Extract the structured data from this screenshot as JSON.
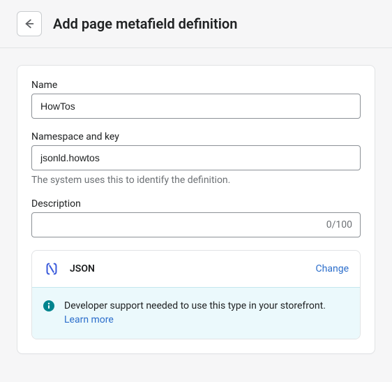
{
  "header": {
    "title": "Add page metafield definition"
  },
  "form": {
    "name": {
      "label": "Name",
      "value": "HowTos"
    },
    "namespace": {
      "label": "Namespace and key",
      "value": "jsonld.howtos",
      "help": "The system uses this to identify the definition."
    },
    "description": {
      "label": "Description",
      "value": "",
      "char_count": "0/100"
    }
  },
  "type_selector": {
    "type_label": "JSON",
    "change_label": "Change",
    "banner_text": "Developer support needed to use this type in your storefront.",
    "learn_more_label": "Learn more"
  }
}
